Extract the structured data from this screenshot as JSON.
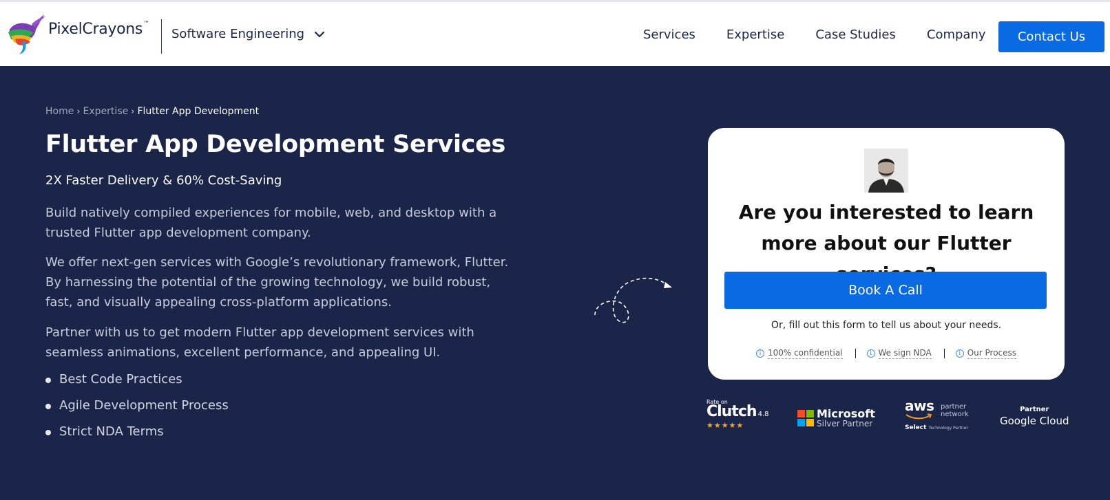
{
  "header": {
    "logo_text": "PixelCrayons",
    "logo_tm": "™",
    "segment_label": "Software Engineering",
    "nav_items": [
      "Services",
      "Expertise",
      "Case Studies",
      "Company"
    ],
    "contact_label": "Contact Us"
  },
  "breadcrumb": {
    "items": [
      "Home",
      "Expertise"
    ],
    "current": "Flutter App Development",
    "separator": "›"
  },
  "hero": {
    "title": "Flutter App Development Services",
    "subtitle": "2X Faster Delivery & 60% Cost-Saving",
    "paragraphs": [
      "Build natively compiled experiences for mobile, web, and desktop with a trusted Flutter app development company.",
      "We offer next-gen services with Google’s revolutionary framework, Flutter. By harnessing the potential of the growing technology, we build robust, fast, and visually appealing cross-platform applications.",
      "Partner with us to get modern Flutter app development services with seamless animations, excellent performance, and appealing UI."
    ],
    "bullets": [
      "Best Code Practices",
      "Agile Development Process",
      "Strict NDA Terms"
    ]
  },
  "card": {
    "title": "Are you interested to learn more about our Flutter services?",
    "book_label": "Book A Call",
    "or_text": "Or, fill out this form to tell us about your needs.",
    "badges": [
      "100% confidential",
      "We sign NDA",
      "Our Process"
    ],
    "info_glyph": "i"
  },
  "partners": {
    "clutch_rate": "Rate on",
    "clutch_name": "Clutch",
    "clutch_score": "4.8",
    "clutch_stars": "★★★★★",
    "ms_name": "Microsoft",
    "ms_sub": "Silver Partner",
    "aws_name": "aws",
    "aws_small": "partner network",
    "aws_select": "Select",
    "aws_tier": "Technology Partner",
    "gc_label": "Partner",
    "gc_name": "Google Cloud"
  },
  "colors": {
    "navy": "#1b2449",
    "accent_blue": "#0a6ae4",
    "white": "#ffffff"
  }
}
